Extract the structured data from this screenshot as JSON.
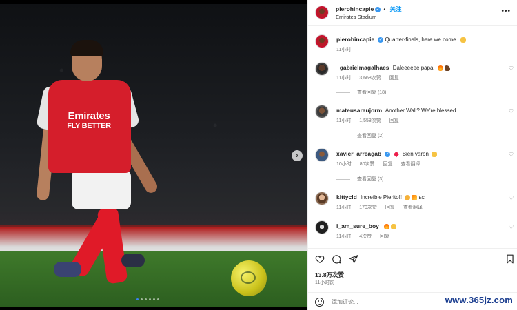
{
  "post": {
    "username": "pierohincapie",
    "follow_label": "关注",
    "location": "Emirates Stadium",
    "more_icon": "more-horizontal-icon",
    "caption": {
      "username": "pierohincapie",
      "text": "Quarter-finals, here we come.",
      "time": "11小时"
    },
    "photo": {
      "sponsor_line1": "Emirates",
      "sponsor_line2": "FLY BETTER",
      "next_icon": "›",
      "dot_count": 6,
      "active_dot": 0
    }
  },
  "comments": [
    {
      "username": "_gabrielmagalhaes",
      "text": "Daleeeeee papai",
      "emojis": [
        "fire",
        "muscle"
      ],
      "time": "11小时",
      "likes": "3,668次赞",
      "reply": "回复",
      "translate": "",
      "view_replies": "查看回复 (18)"
    },
    {
      "username": "mateusarauj​orm",
      "text": "Another Wall? We're blessed",
      "emojis": [],
      "time": "11小时",
      "likes": "1,558次赞",
      "reply": "回复",
      "translate": "",
      "view_replies": "查看回复 (2)"
    },
    {
      "username": "xavier_arreagab",
      "text": "Bien varon",
      "emojis": [
        "heart",
        "hands"
      ],
      "time": "10小时",
      "likes": "80次赞",
      "reply": "回复",
      "translate": "查看翻译",
      "view_replies": "查看回复 (3)"
    },
    {
      "username": "kittycld",
      "text": "Increíble Pierito!!",
      "emojis": [
        "face",
        "party"
      ],
      "suffix": "EC",
      "time": "11小时",
      "likes": "170次赞",
      "reply": "回复",
      "translate": "查看翻译",
      "view_replies": ""
    },
    {
      "username": "i_am_sure_boy",
      "text": "",
      "emojis": [
        "fire",
        "hands"
      ],
      "time": "11小时",
      "likes": "4次赞",
      "reply": "回复",
      "translate": "",
      "view_replies": ""
    }
  ],
  "actions": {
    "like_icon": "heart-icon",
    "comment_icon": "comment-icon",
    "share_icon": "send-icon",
    "save_icon": "bookmark-icon"
  },
  "stats": {
    "likes": "13.8万次赞",
    "posted": "11小时前"
  },
  "comment_box": {
    "placeholder": "添加评论..."
  },
  "watermark": "www.365jz.com",
  "colors": {
    "link": "#0095f6",
    "verified": "#3897f0",
    "secondary_text": "#737373"
  }
}
